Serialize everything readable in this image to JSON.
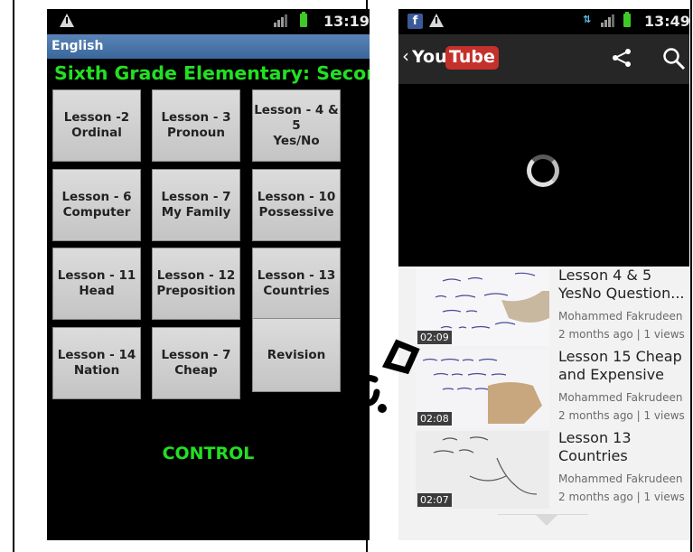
{
  "left_app": {
    "statusbar": {
      "time": "13:19"
    },
    "title": "English",
    "heading": "Sixth Grade Elementary: Second",
    "lessons": [
      {
        "line1": "Lesson -2",
        "line2": "Ordinal"
      },
      {
        "line1": "Lesson - 3",
        "line2": "Pronoun"
      },
      {
        "line1": "Lesson - 4 & 5",
        "line2": "Yes/No"
      },
      {
        "line1": "Lesson - 6",
        "line2": "Computer"
      },
      {
        "line1": "Lesson - 7",
        "line2": "My Family"
      },
      {
        "line1": "Lesson - 10",
        "line2": "Possessive"
      },
      {
        "line1": "Lesson - 11",
        "line2": "Head"
      },
      {
        "line1": "Lesson - 12",
        "line2": "Preposition"
      },
      {
        "line1": "Lesson - 13",
        "line2": "Countries"
      },
      {
        "line1": "Lesson - 14",
        "line2": "Nation"
      },
      {
        "line1": "Lesson - 7",
        "line2": "Cheap"
      },
      {
        "line1": "Revision",
        "line2": ""
      }
    ],
    "control_label": "CONTROL"
  },
  "right_app": {
    "statusbar": {
      "time": "13:49",
      "fb_icon": "f"
    },
    "toolbar": {
      "back": "‹",
      "logo_you": "You",
      "logo_tube": "Tube"
    },
    "videos": [
      {
        "title": "Lesson 4 & 5 YesNo Question...",
        "author": "Mohammed Fakrudeen",
        "meta": "2 months ago | 1 views",
        "duration": "02:09"
      },
      {
        "title": "Lesson 15 Cheap and Expensive",
        "author": "Mohammed Fakrudeen",
        "meta": "2 months ago | 1 views",
        "duration": "02:08"
      },
      {
        "title": "Lesson 13 Countries",
        "author": "Mohammed Fakrudeen",
        "meta": "2 months ago | 1 views",
        "duration": "02:07"
      }
    ]
  },
  "colors": {
    "accent_green": "#22e022",
    "youtube_red": "#c4302b",
    "titlebar_blue": "#3a679c"
  }
}
